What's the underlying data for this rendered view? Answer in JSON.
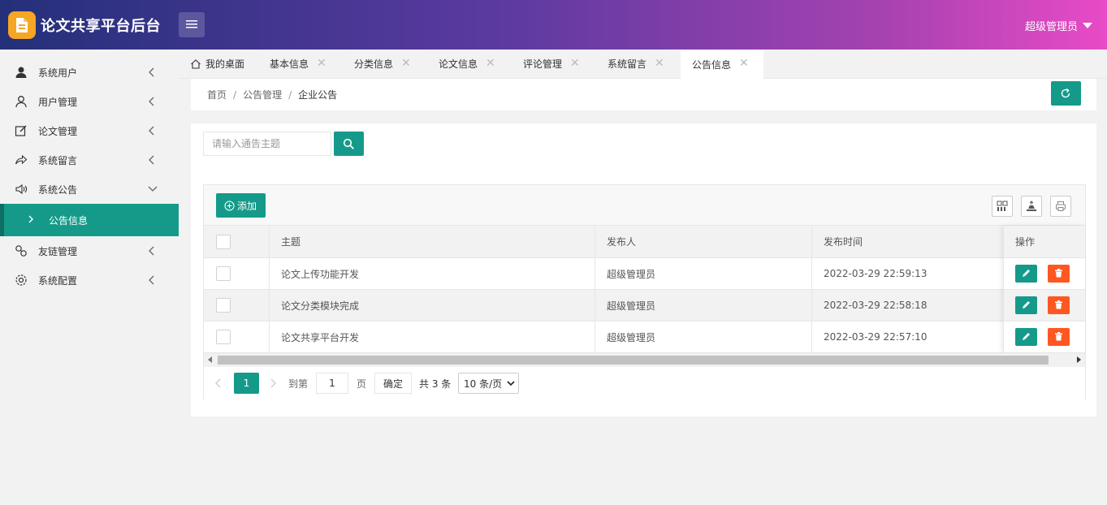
{
  "app": {
    "title": "论文共享平台后台",
    "user_label": "超级管理员"
  },
  "sidebar": {
    "items": [
      {
        "label": "系统用户",
        "icon": "person-filled-icon"
      },
      {
        "label": "用户管理",
        "icon": "person-outline-icon"
      },
      {
        "label": "论文管理",
        "icon": "edit-square-icon"
      },
      {
        "label": "系统留言",
        "icon": "share-arrow-icon"
      },
      {
        "label": "系统公告",
        "icon": "speaker-icon"
      },
      {
        "label": "友链管理",
        "icon": "link-icon"
      },
      {
        "label": "系统配置",
        "icon": "gear-icon"
      }
    ],
    "active_sub": "公告信息"
  },
  "tabs": [
    {
      "label": "我的桌面",
      "closable": false
    },
    {
      "label": "基本信息",
      "closable": true
    },
    {
      "label": "分类信息",
      "closable": true
    },
    {
      "label": "论文信息",
      "closable": true
    },
    {
      "label": "评论管理",
      "closable": true
    },
    {
      "label": "系统留言",
      "closable": true
    },
    {
      "label": "公告信息",
      "closable": true,
      "active": true
    }
  ],
  "breadcrumb": [
    "首页",
    "公告管理",
    "企业公告"
  ],
  "search": {
    "placeholder": "请输入通告主题"
  },
  "toolbar": {
    "add_label": "添加"
  },
  "table": {
    "columns": [
      "主题",
      "发布人",
      "发布时间",
      "操作"
    ],
    "rows": [
      {
        "title": "论文上传功能开发",
        "author": "超级管理员",
        "time": "2022-03-29 22:59:13"
      },
      {
        "title": "论文分类模块完成",
        "author": "超级管理员",
        "time": "2022-03-29 22:58:18"
      },
      {
        "title": "论文共享平台开发",
        "author": "超级管理员",
        "time": "2022-03-29 22:57:10"
      }
    ]
  },
  "pager": {
    "current_page": "1",
    "goto_label": "到第",
    "goto_value": "1",
    "page_unit": "页",
    "confirm_label": "确定",
    "total_label": "共 3 条",
    "page_size": "10 条/页"
  },
  "colors": {
    "primary": "#159a8a",
    "danger": "#ff5722"
  }
}
